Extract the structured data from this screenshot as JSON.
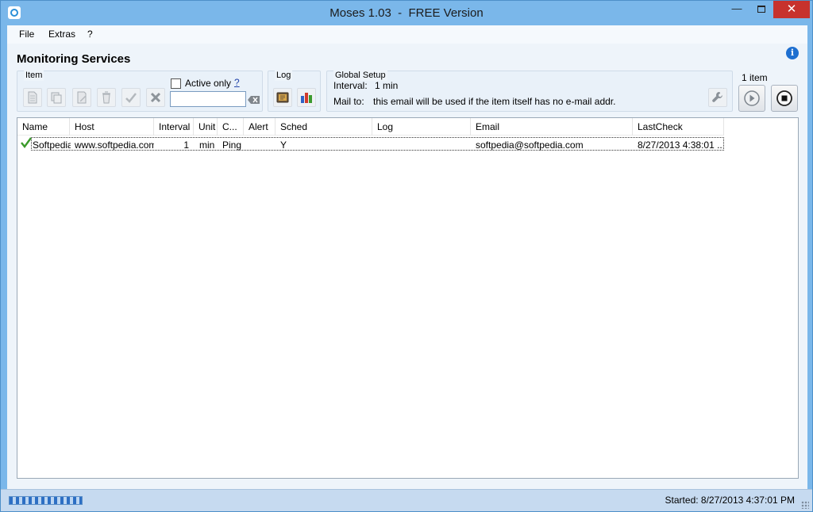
{
  "window": {
    "title": "Moses 1.03  -  FREE Version",
    "min_glyph": "—",
    "close_glyph": "✕"
  },
  "menu": [
    "File",
    "Extras",
    "?"
  ],
  "page": {
    "title": "Monitoring Services"
  },
  "item_group": {
    "label": "Item",
    "active_only_label": "Active only",
    "active_only_checked": false,
    "help": "?",
    "filter_value": "",
    "buttons": [
      "new-item-icon",
      "copy-item-icon",
      "edit-item-icon",
      "delete-item-icon",
      "activate-check-icon",
      "deactivate-x-icon"
    ]
  },
  "log_group": {
    "label": "Log",
    "buttons": [
      "log-viewer-icon",
      "log-chart-icon"
    ]
  },
  "global_setup": {
    "label": "Global Setup",
    "interval_label": "Interval:",
    "interval_value": "1 min",
    "mailto_label": "Mail to:",
    "mailto_note": "this email will be used if the item itself has no e-mail addr."
  },
  "run_group": {
    "count_label": "1  item"
  },
  "table": {
    "columns": [
      "Name",
      "Host",
      "Interval",
      "Unit",
      "C...",
      "Alert",
      "Sched",
      "Log",
      "Email",
      "LastCheck"
    ],
    "rows": [
      {
        "status": "ok",
        "name": "Softpedia",
        "host": "www.softpedia.com",
        "interval": "1",
        "unit": "min",
        "check": "Ping",
        "alert": "",
        "sched": "Y",
        "log": "",
        "email": "softpedia@softpedia.com",
        "last_check": "8/27/2013 4:38:01 ..."
      }
    ]
  },
  "status": {
    "text": "Started: 8/27/2013 4:37:01 PM"
  },
  "colors": {
    "accent": "#1e6fd0",
    "titlebar": "#7ab7ea",
    "close": "#c7322d",
    "ok_check": "#3a9a2a"
  }
}
